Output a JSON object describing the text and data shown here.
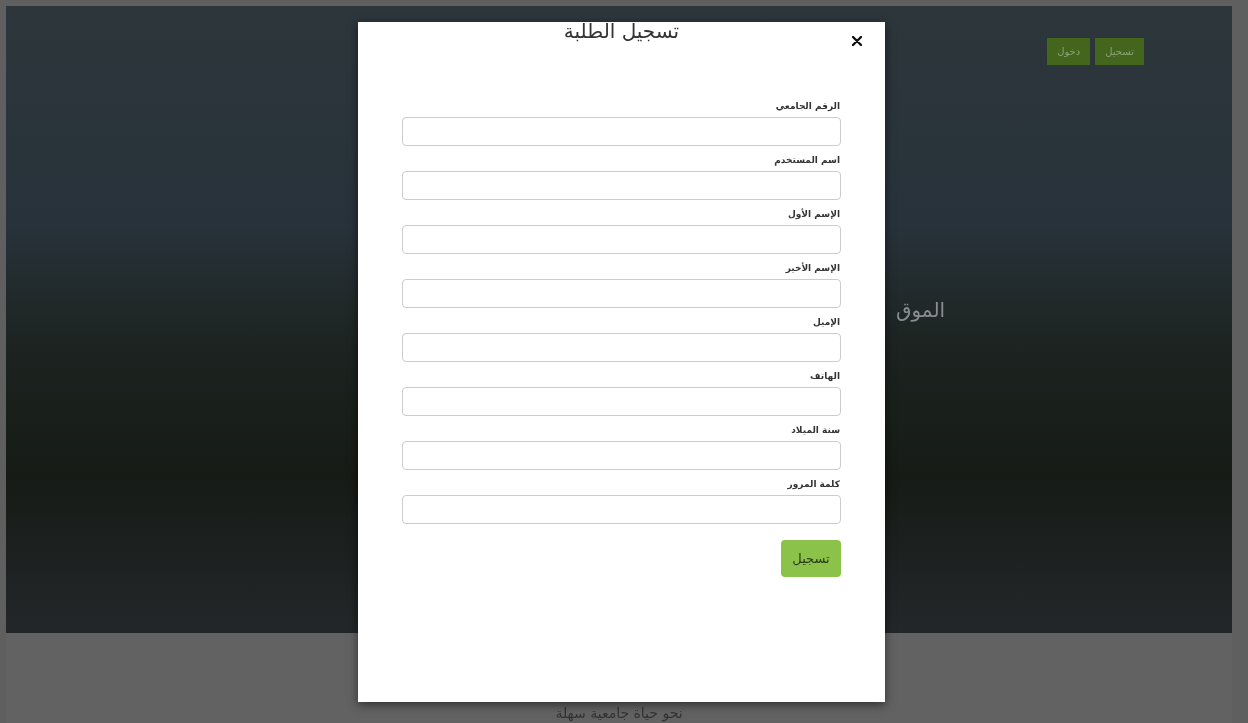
{
  "page": {
    "nav_buttons": [
      "تسجيل",
      "دخول"
    ],
    "hero_heading": "الموق",
    "tagline": "نحو حياة جامعية سهلة"
  },
  "modal": {
    "title": "تسجيل الطلبة",
    "fields": [
      {
        "label": "الرقم الجامعي"
      },
      {
        "label": "اسم المستخدم"
      },
      {
        "label": "الإسم الأول"
      },
      {
        "label": "الإسم الأخير"
      },
      {
        "label": "الإميل"
      },
      {
        "label": "الهاتف"
      },
      {
        "label": "سنة الميلاد"
      },
      {
        "label": "كلمة المرور"
      }
    ],
    "submit": "تسجيل"
  }
}
